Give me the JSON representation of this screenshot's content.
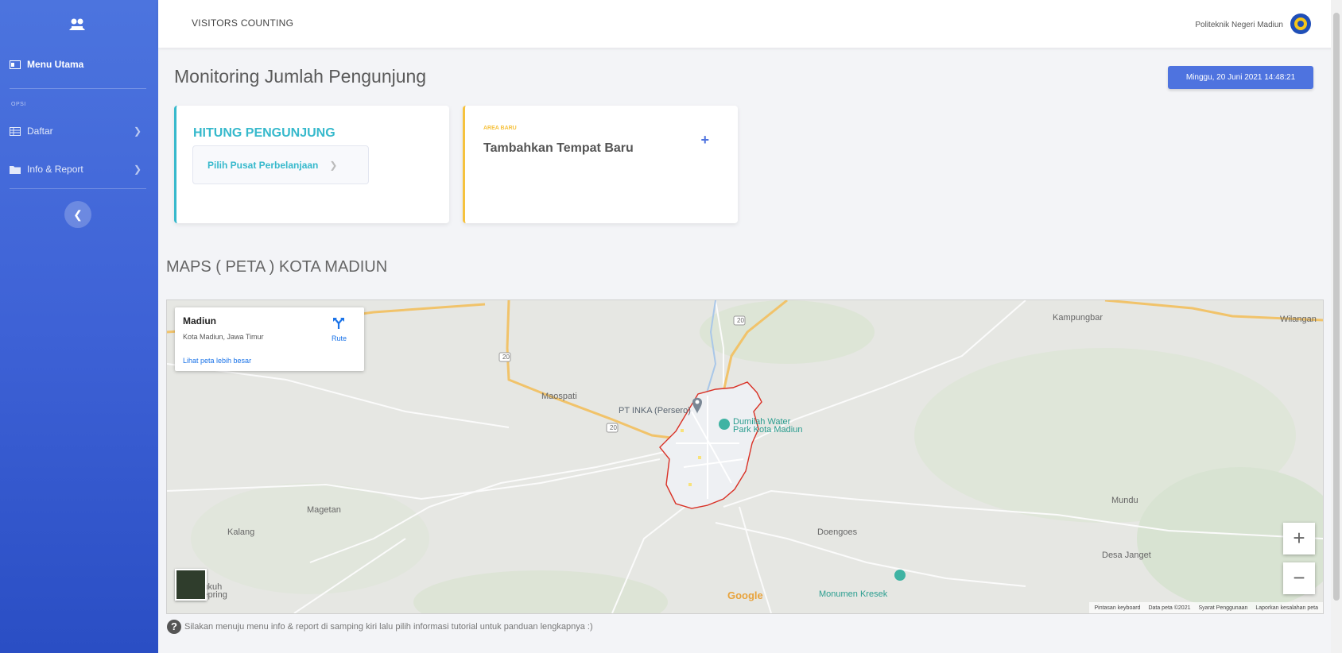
{
  "sidebar": {
    "brand_icon": "users-icon",
    "menu_utama": "Menu Utama",
    "section_heading": "OPSI",
    "items": [
      {
        "label": "Daftar",
        "icon": "table-icon"
      },
      {
        "label": "Info & Report",
        "icon": "folder-icon"
      }
    ],
    "collapse_icon": "chevron-left-icon"
  },
  "topbar": {
    "app_title": "VISITORS COUNTING",
    "org_name": "Politeknik Negeri Madiun",
    "org_logo": "polinema-logo"
  },
  "main": {
    "page_title": "Monitoring Jumlah Pengunjung",
    "datetime": "Minggu, 20 Juni 2021 14:48:21",
    "cards": {
      "hitung": {
        "title": "HITUNG PENGUNJUNG",
        "button_label": "Pilih Pusat Perbelanjaan",
        "accent": "#36b9cc"
      },
      "baru": {
        "label": "AREA BARU",
        "title": "Tambahkan Tempat Baru",
        "plus": "+",
        "accent": "#f6c23e"
      }
    },
    "maps_title": "MAPS ( PETA ) KOTA MADIUN"
  },
  "map": {
    "info": {
      "name": "Madiun",
      "sub": "Kota Madiun, Jawa Timur",
      "route_label": "Rute",
      "larger_map": "Lihat peta lebih besar"
    },
    "labels": {
      "kampungbar": "Kampungbar",
      "wilangan": "Wilangan",
      "maospati": "Maospati",
      "pt_inka": "PT INKA (Persero)",
      "dumilah_1": "Dumilah Water",
      "dumilah_2": "Park Kota Madiun",
      "magetan": "Magetan",
      "kalang": "Kalang",
      "doengoes": "Doengoes",
      "mundu": "Mundu",
      "desa_janget": "Desa Janget",
      "sukuh_1": "Sukuh",
      "sukuh_2": "Sepring",
      "monumen": "Monumen Kresek",
      "road_20a": "20",
      "road_20b": "20",
      "road_20c": "20"
    },
    "google": "Google",
    "zoom_in": "+",
    "zoom_out": "−",
    "attribution": {
      "keyboard": "Pintasan keyboard",
      "data": "Data peta ©2021",
      "terms": "Syarat Penggunaan",
      "report": "Laporkan kesalahan peta"
    }
  },
  "help_text": "Silakan menuju menu info & report di samping kiri lalu pilih informasi tutorial untuk panduan lengkapnya :)",
  "colors": {
    "primary": "#4e73df",
    "teal": "#36b9cc",
    "warning": "#f6c23e",
    "city_border": "#d93025"
  }
}
